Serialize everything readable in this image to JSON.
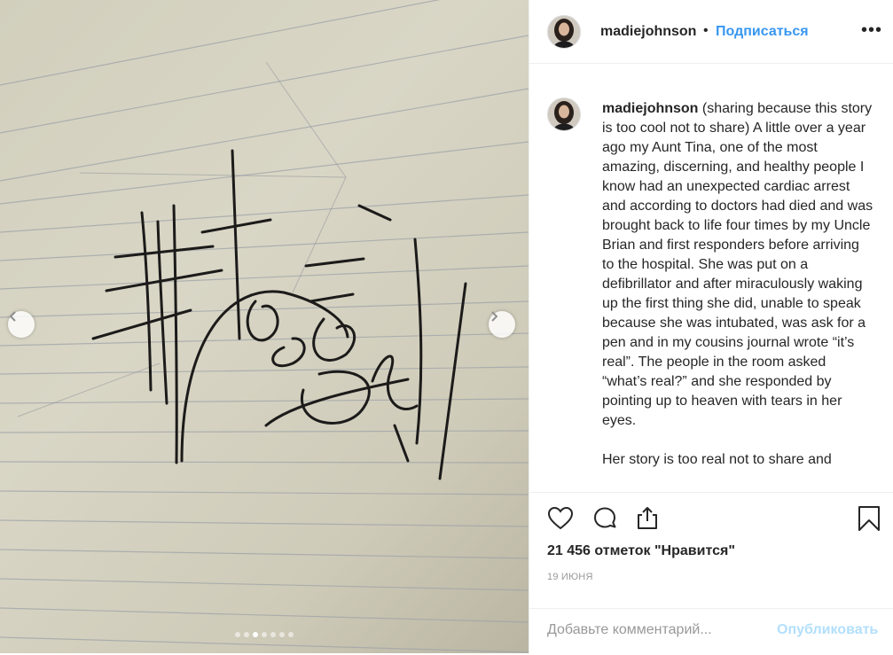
{
  "post": {
    "username": "madiejohnson",
    "separator": "•",
    "follow_label": "Подписаться",
    "more_label": "•••"
  },
  "caption": {
    "username": "madiejohnson",
    "paragraph1": "(sharing because this story is too cool not to share) A little over a year ago my Aunt Tina, one of the most amazing, discerning, and healthy people I know had an unexpected cardiac arrest and according to doctors had died and was brought back to life four times by my Uncle Brian and first responders before arriving to the hospital. She was put on a defibrillator and after miraculously waking up the first thing she did, unable to speak because she was intubated, was ask for a pen and in my cousins journal wrote “it’s real”. The people in the room asked “what’s real?” and she responded by pointing up to heaven with tears in her eyes.",
    "paragraph2": "Her story is too real not to share and"
  },
  "actions": {
    "likes_text": "21 456 отметок \"Нравится\"",
    "date_text": "19 ИЮНЯ",
    "comment_placeholder": "Добавьте комментарий...",
    "publish_label": "Опубликовать"
  },
  "media": {
    "slide_count": 7,
    "active_slide": 3,
    "icons": [
      "chevron-left-icon",
      "chevron-right-icon"
    ]
  },
  "colors": {
    "accent": "#3897f0",
    "publish_disabled": "#b2dffc",
    "muted": "#999999",
    "text": "#262626"
  }
}
